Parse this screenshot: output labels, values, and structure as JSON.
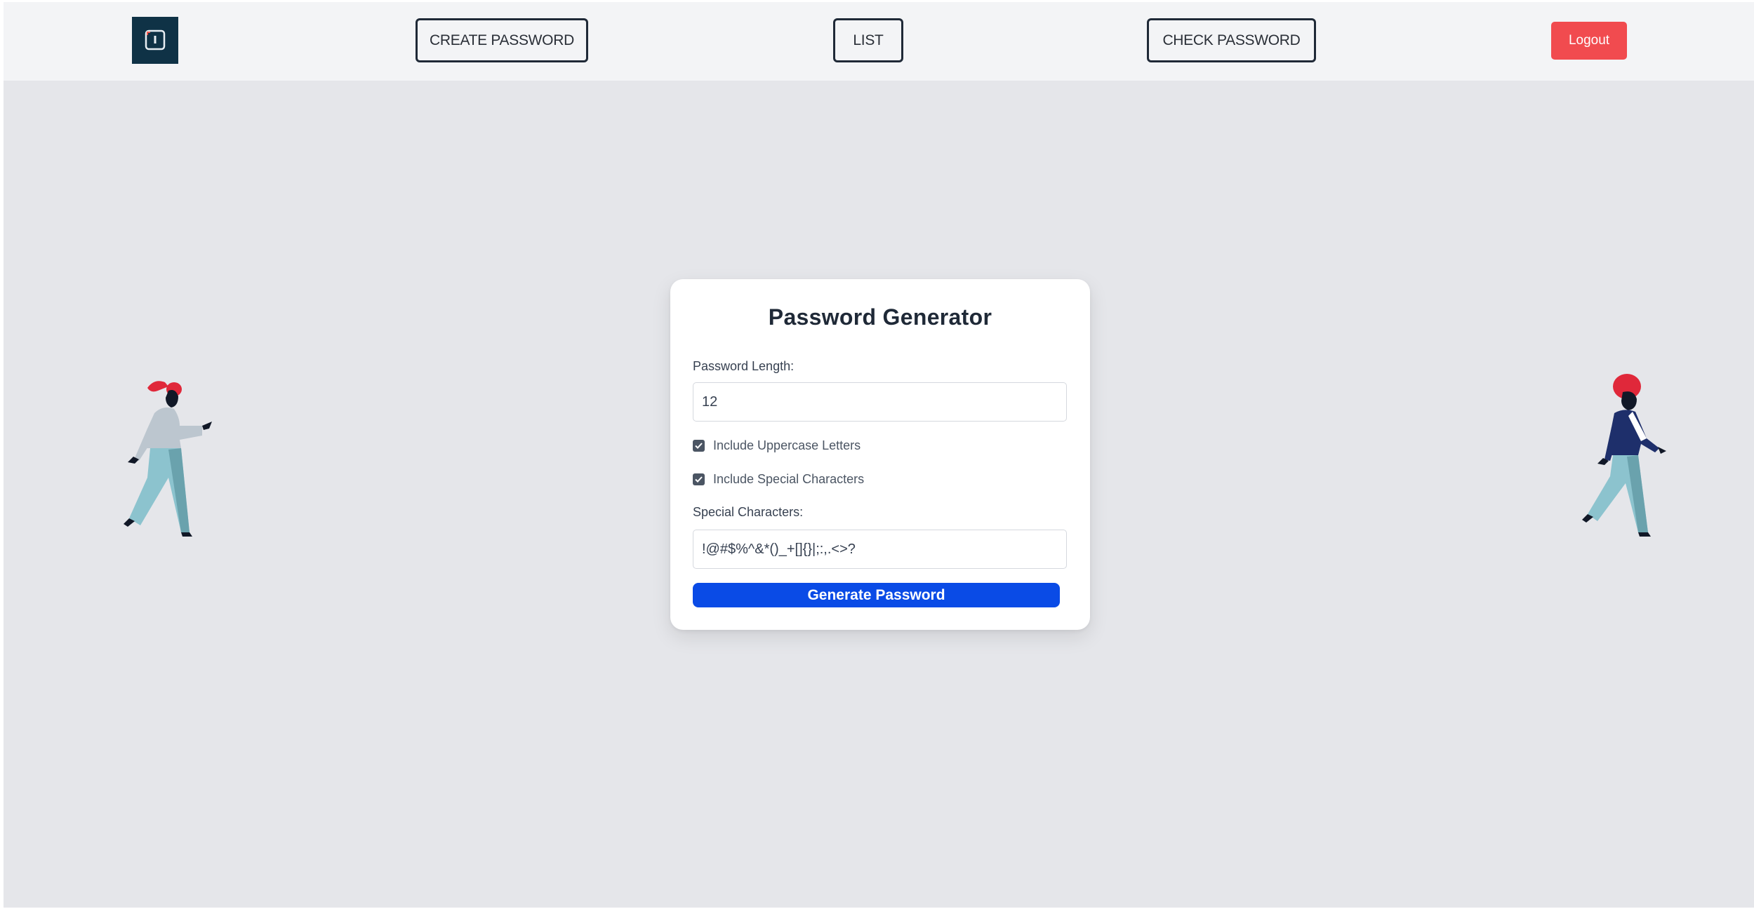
{
  "nav": {
    "create_password": "CREATE PASSWORD",
    "list": "LIST",
    "check_password": "CHECK PASSWORD",
    "logout": "Logout"
  },
  "generator": {
    "title": "Password Generator",
    "length_label": "Password Length:",
    "length_value": "12",
    "uppercase_label": "Include Uppercase Letters",
    "uppercase_checked": true,
    "special_label": "Include Special Characters",
    "special_checked": true,
    "special_chars_label": "Special Characters:",
    "special_chars_value": "!@#$%^&*()_+[]{}|;:,.<>?",
    "generate_button": "Generate Password"
  },
  "colors": {
    "accent": "#0a4be6",
    "logout": "#f14b4f",
    "logo_bg": "#0f3246"
  }
}
